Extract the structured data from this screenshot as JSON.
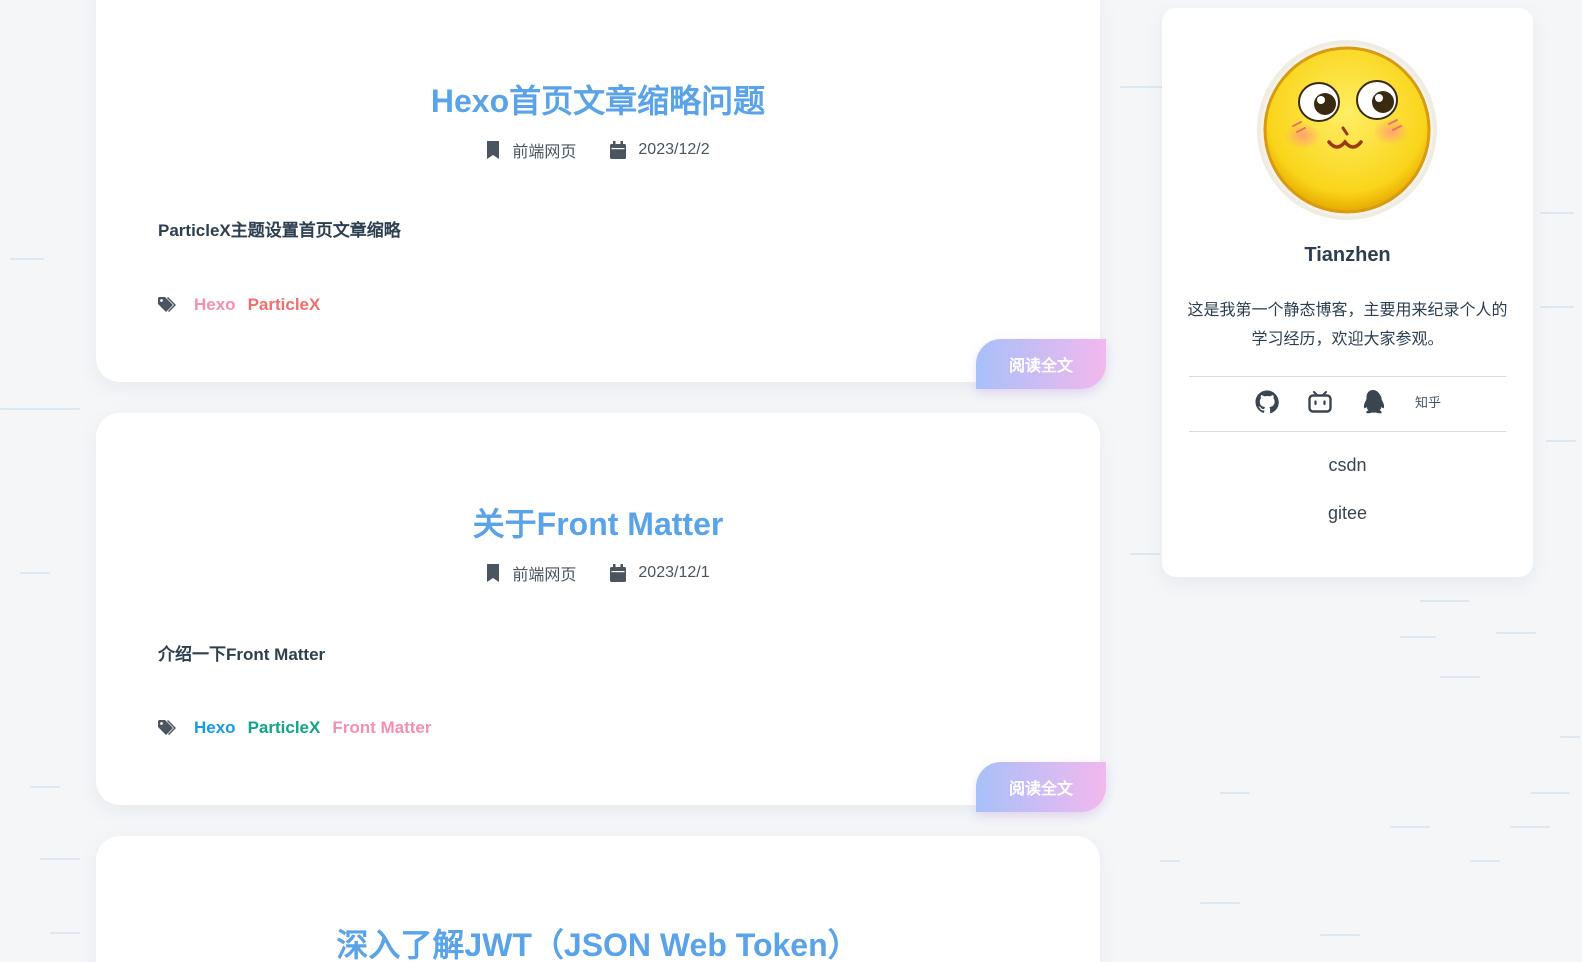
{
  "posts": [
    {
      "title": "Hexo首页文章缩略问题",
      "category": "前端网页",
      "date": "2023/12/2",
      "excerpt": "ParticleX主题设置首页文章缩略",
      "tags": [
        {
          "label": "Hexo",
          "color": "#f48fb1"
        },
        {
          "label": "ParticleX",
          "color": "#ef6f6c"
        }
      ],
      "read_more": "阅读全文"
    },
    {
      "title": "关于Front Matter",
      "category": "前端网页",
      "date": "2023/12/1",
      "excerpt": "介绍一下Front Matter",
      "tags": [
        {
          "label": "Hexo",
          "color": "#1a9be0"
        },
        {
          "label": "ParticleX",
          "color": "#14a38a"
        },
        {
          "label": "Front Matter",
          "color": "#f48fb1"
        }
      ],
      "read_more": "阅读全文"
    },
    {
      "title": "深入了解JWT（JSON Web Token）"
    }
  ],
  "sidebar": {
    "name": "Tianzhen",
    "bio": "这是我第一个静态博客，主要用来纪录个人的学习经历，欢迎大家参观。",
    "social": {
      "icons": [
        "github-icon",
        "bilibili-icon",
        "qq-icon"
      ],
      "zhihu_label": "知乎"
    },
    "links": [
      "csdn",
      "gitee"
    ]
  },
  "colors": {
    "title": "#5aa3e8",
    "read_more_gradient": [
      "#a8c0f8",
      "#f2b8ee"
    ]
  }
}
